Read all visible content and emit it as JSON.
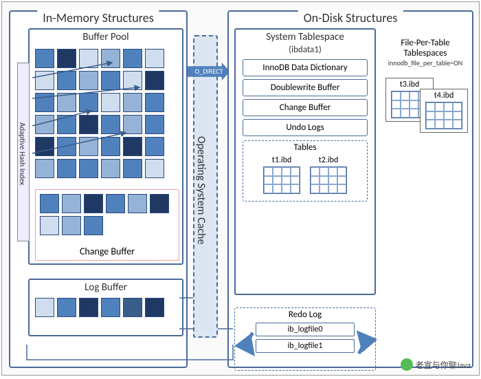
{
  "in_memory": {
    "title": "In-Memory Structures",
    "buffer_pool": {
      "title": "Buffer Pool"
    },
    "adaptive_hash_index": "Adaptive Hash Index",
    "change_buffer": "Change Buffer",
    "log_buffer": {
      "title": "Log Buffer"
    }
  },
  "os_cache": "Operating System Cache",
  "o_direct": "O_DIRECT",
  "on_disk": {
    "title": "On-Disk Structures",
    "system_tablespace": {
      "title": "System Tablespace",
      "subtitle": "(ibdata1)",
      "items": [
        "InnoDB Data Dictionary",
        "Doublewrite Buffer",
        "Change Buffer",
        "Undo Logs"
      ],
      "tables": {
        "title": "Tables",
        "items": [
          "t1.ibd",
          "t2.ibd"
        ]
      }
    },
    "file_per_table": {
      "title": "File-Per-Table Tablespaces",
      "config": "innodb_file_per_table=ON",
      "items": [
        "t3.ibd",
        "t4.ibd"
      ]
    },
    "redo_log": {
      "title": "Redo Log",
      "files": [
        "ib_logfile0",
        "ib_logfile1"
      ]
    }
  },
  "watermark": "老宣与你聊Java"
}
